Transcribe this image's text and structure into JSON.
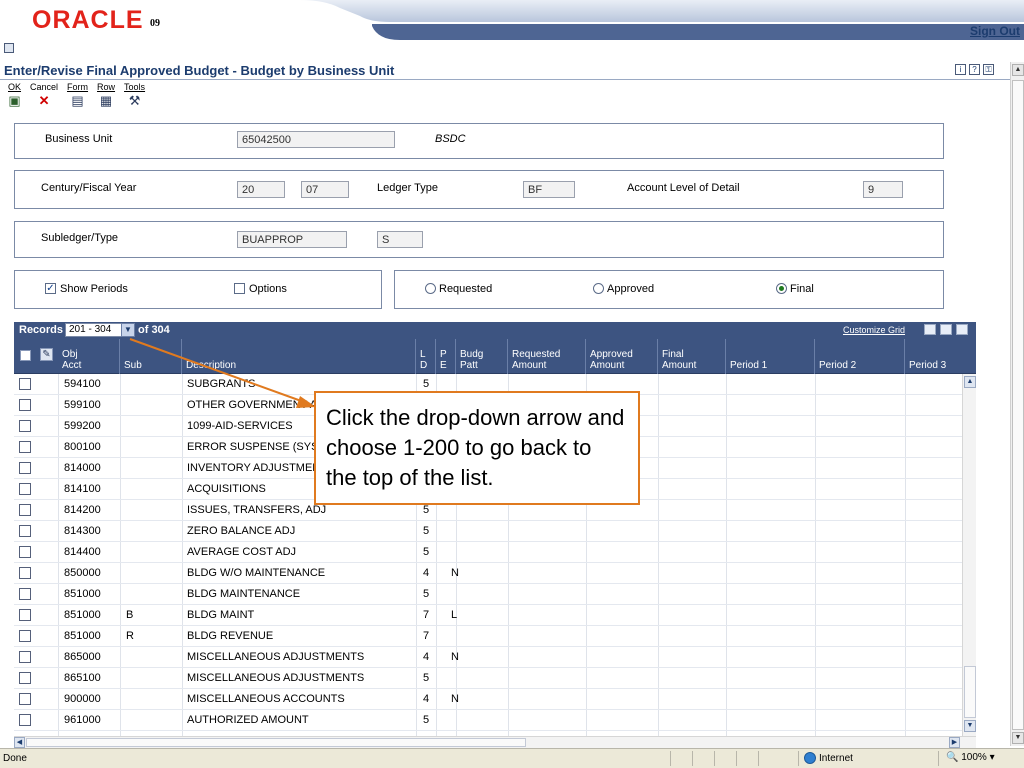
{
  "header": {
    "logo_text": "ORACLE",
    "logo_version": "09",
    "sign_out": "Sign Out"
  },
  "page": {
    "title": "Enter/Revise Final Approved Budget - Budget by Business Unit",
    "help_icons": [
      "i",
      "?",
      "⚿"
    ]
  },
  "toolbar": {
    "ok": "OK",
    "cancel": "Cancel",
    "form": "Form",
    "row": "Row",
    "tools": "Tools"
  },
  "form": {
    "business_unit_label": "Business Unit",
    "business_unit_value": "65042500",
    "business_unit_desc": "BSDC",
    "century_fy_label": "Century/Fiscal Year",
    "century_value": "20",
    "fiscal_year_value": "07",
    "ledger_type_label": "Ledger Type",
    "ledger_type_value": "BF",
    "account_level_label": "Account Level of Detail",
    "account_level_value": "9",
    "subledger_label": "Subledger/Type",
    "subledger_value": "BUAPPROP",
    "subledger_type_value": "S",
    "show_periods_label": "Show Periods",
    "show_periods_checked": true,
    "options_label": "Options",
    "options_checked": false,
    "radio_requested": "Requested",
    "radio_approved": "Approved",
    "radio_final": "Final",
    "selected_radio": "Final"
  },
  "grid": {
    "records_label": "Records",
    "records_range": "201 - 304",
    "records_of": "of 304",
    "customize_link": "Customize Grid",
    "columns": [
      {
        "line1": "Obj",
        "line2": "Acct"
      },
      {
        "line1": "",
        "line2": "Sub"
      },
      {
        "line1": "",
        "line2": "Description"
      },
      {
        "line1": "L",
        "line2": "D"
      },
      {
        "line1": "P",
        "line2": "E"
      },
      {
        "line1": "Budg",
        "line2": "Patt"
      },
      {
        "line1": "Requested",
        "line2": "Amount"
      },
      {
        "line1": "Approved",
        "line2": "Amount"
      },
      {
        "line1": "Final",
        "line2": "Amount"
      },
      {
        "line1": "",
        "line2": "Period 1"
      },
      {
        "line1": "",
        "line2": "Period 2"
      },
      {
        "line1": "",
        "line2": "Period 3"
      }
    ],
    "rows": [
      {
        "obj": "594100",
        "sub": "",
        "desc": "SUBGRANTS",
        "ld": "5",
        "pe": ""
      },
      {
        "obj": "599100",
        "sub": "",
        "desc": "OTHER GOVERNMENT AI",
        "ld": "",
        "pe": ""
      },
      {
        "obj": "599200",
        "sub": "",
        "desc": "1099-AID-SERVICES",
        "ld": "",
        "pe": ""
      },
      {
        "obj": "800100",
        "sub": "",
        "desc": "ERROR SUSPENSE (SYS",
        "ld": "",
        "pe": ""
      },
      {
        "obj": "814000",
        "sub": "",
        "desc": "INVENTORY ADJUSTMEN",
        "ld": "",
        "pe": ""
      },
      {
        "obj": "814100",
        "sub": "",
        "desc": "ACQUISITIONS",
        "ld": "",
        "pe": ""
      },
      {
        "obj": "814200",
        "sub": "",
        "desc": "ISSUES, TRANSFERS, ADJ",
        "ld": "5",
        "pe": ""
      },
      {
        "obj": "814300",
        "sub": "",
        "desc": "ZERO BALANCE ADJ",
        "ld": "5",
        "pe": ""
      },
      {
        "obj": "814400",
        "sub": "",
        "desc": "AVERAGE COST ADJ",
        "ld": "5",
        "pe": ""
      },
      {
        "obj": "850000",
        "sub": "",
        "desc": "BLDG W/O MAINTENANCE",
        "ld": "4",
        "pe": "N"
      },
      {
        "obj": "851000",
        "sub": "",
        "desc": "BLDG MAINTENANCE",
        "ld": "5",
        "pe": ""
      },
      {
        "obj": "851000",
        "sub": "B",
        "desc": "BLDG MAINT",
        "ld": "7",
        "pe": "L"
      },
      {
        "obj": "851000",
        "sub": "R",
        "desc": "BLDG REVENUE",
        "ld": "7",
        "pe": ""
      },
      {
        "obj": "865000",
        "sub": "",
        "desc": "MISCELLANEOUS ADJUSTMENTS",
        "ld": "4",
        "pe": "N"
      },
      {
        "obj": "865100",
        "sub": "",
        "desc": "MISCELLANEOUS ADJUSTMENTS",
        "ld": "5",
        "pe": ""
      },
      {
        "obj": "900000",
        "sub": "",
        "desc": "MISCELLANEOUS ACCOUNTS",
        "ld": "4",
        "pe": "N"
      },
      {
        "obj": "961000",
        "sub": "",
        "desc": "AUTHORIZED AMOUNT",
        "ld": "5",
        "pe": ""
      }
    ]
  },
  "callout": {
    "text": "Click the drop-down arrow and choose 1-200 to go back to the top of the list."
  },
  "status": {
    "left": "Done",
    "zone": "Internet",
    "zoom": "100%"
  },
  "colors": {
    "brand_red": "#e2231a",
    "header_blue": "#3d5481",
    "callout_orange": "#e07a1f"
  }
}
